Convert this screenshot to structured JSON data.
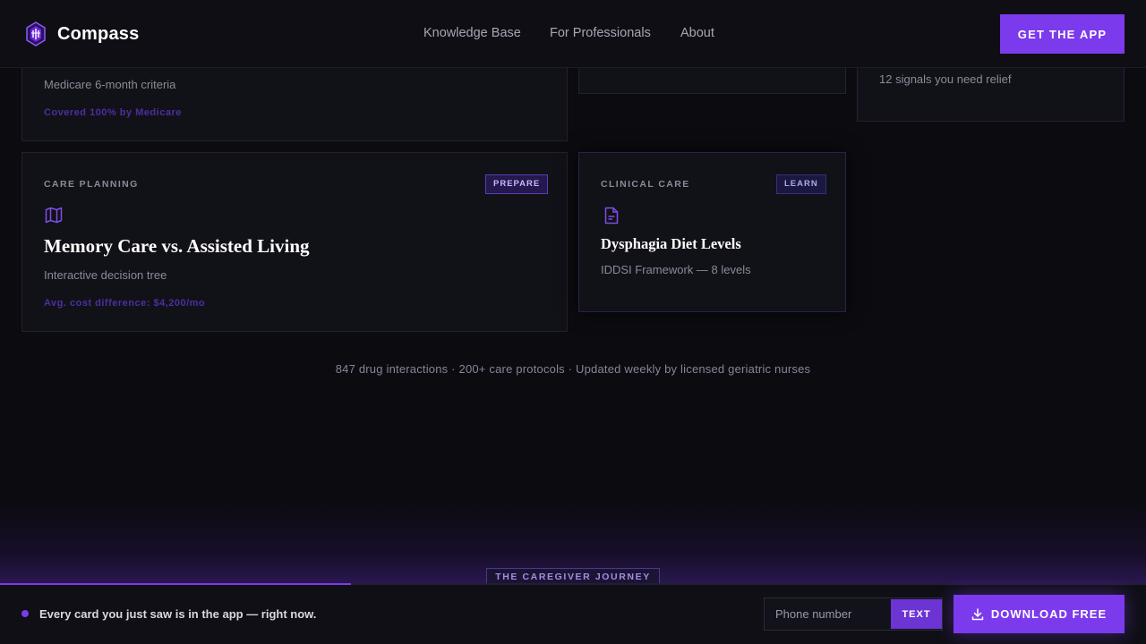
{
  "header": {
    "brand": "Compass",
    "nav": [
      "Knowledge Base",
      "For Professionals",
      "About"
    ],
    "cta": "GET THE APP"
  },
  "cards": {
    "top_left": {
      "subtitle": "Medicare 6-month criteria",
      "note": "Covered 100% by Medicare"
    },
    "top_right": {
      "subtitle": "12 signals you need relief"
    },
    "care_planning": {
      "category": "CARE PLANNING",
      "badge": "PREPARE",
      "icon": "map-icon",
      "title": "Memory Care vs. Assisted Living",
      "subtitle": "Interactive decision tree",
      "note": "Avg. cost difference: $4,200/mo"
    },
    "clinical_care": {
      "category": "CLINICAL CARE",
      "badge": "LEARN",
      "icon": "document-icon",
      "title": "Dysphagia Diet Levels",
      "subtitle": "IDDSI Framework — 8 levels"
    }
  },
  "stats": "847 drug interactions · 200+ care protocols · Updated weekly by licensed geriatric nurses",
  "journey_label": "THE CAREGIVER JOURNEY",
  "bottom_bar": {
    "message": "Every card you just saw is in the app — right now.",
    "phone_placeholder": "Phone number",
    "text_button": "TEXT",
    "download_button": "DOWNLOAD FREE",
    "progress": 0.306
  },
  "colors": {
    "accent": "#7c3aed",
    "background": "#0b0b10",
    "card": "#111118"
  }
}
